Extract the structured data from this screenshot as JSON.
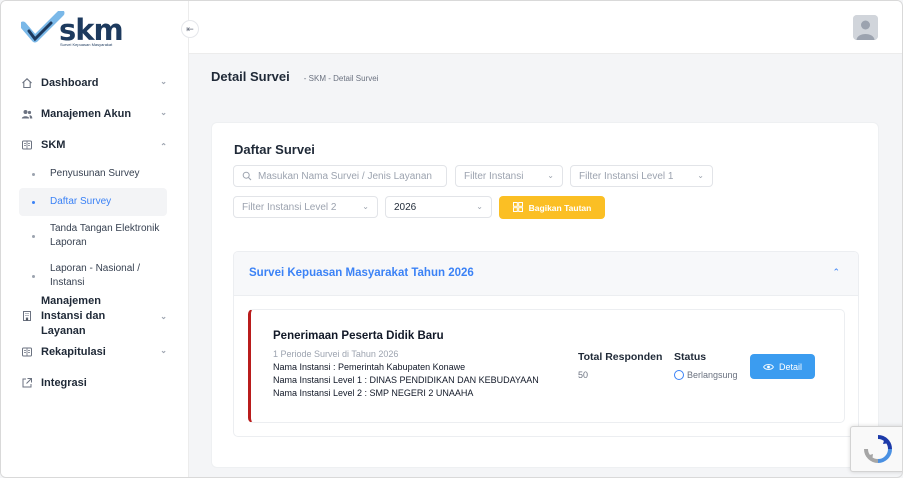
{
  "brand": {
    "logo_text": "skm",
    "logo_subtitle": "Survei Kepuasan Masyarakat"
  },
  "sidebar": {
    "items": [
      {
        "label": "Dashboard",
        "icon": "home-icon",
        "chevron": "down"
      },
      {
        "label": "Manajemen Akun",
        "icon": "users-icon",
        "chevron": "down"
      },
      {
        "label": "SKM",
        "icon": "book-icon",
        "chevron": "up"
      },
      {
        "label": "Manajemen Instansi dan Layanan",
        "icon": "building-icon",
        "chevron": "down"
      },
      {
        "label": "Rekapitulasi",
        "icon": "book-icon",
        "chevron": "down"
      },
      {
        "label": "Integrasi",
        "icon": "external-link-icon"
      }
    ],
    "skm_sub": [
      {
        "label": "Penyusunan Survey"
      },
      {
        "label": "Daftar Survey",
        "active": true
      },
      {
        "label": "Tanda Tangan Elektronik Laporan"
      },
      {
        "label": "Laporan - Nasional / Instansi"
      }
    ]
  },
  "header": {
    "page_title": "Detail Survei",
    "breadcrumb": "- SKM - Detail Survei"
  },
  "card": {
    "title": "Daftar Survei",
    "search_placeholder": "Masukan Nama Survei / Jenis Layanan",
    "filter_instansi": "Filter Instansi",
    "filter_instansi_level1": "Filter Instansi Level 1",
    "filter_instansi_level2": "Filter Instansi Level 2",
    "year": "2026",
    "share_label": "Bagikan Tautan"
  },
  "accordion": {
    "title": "Survei Kepuasan Masyarakat Tahun 2026"
  },
  "survey": {
    "name": "Penerimaan Peserta Didik Baru",
    "period": "1 Periode Survei di Tahun 2026",
    "instansi": "Nama Instansi : Pemerintah Kabupaten Konawe",
    "instansi_level1": "Nama Instansi Level 1 : DINAS PENDIDIKAN DAN KEBUDAYAAN",
    "instansi_level2": "Nama Instansi Level 2 : SMP NEGERI 2 UNAAHA",
    "responden_label": "Total Responden",
    "responden_value": "50",
    "status_label": "Status",
    "status_value": "Berlangsung",
    "detail_label": "Detail"
  },
  "colors": {
    "primary": "#3b82f6",
    "accent_yellow": "#fbbf24",
    "survey_border": "#b91c1c",
    "brand_navy": "#1d3a5e",
    "brand_light_blue": "#7ab8e8"
  }
}
